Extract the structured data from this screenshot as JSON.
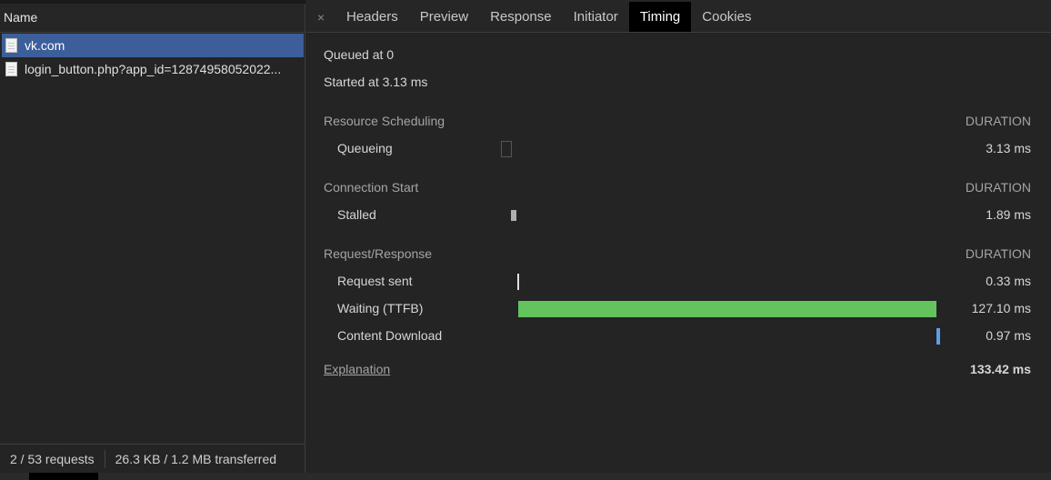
{
  "requests_panel": {
    "header": "Name",
    "items": [
      {
        "name": "vk.com",
        "selected": true
      },
      {
        "name": "login_button.php?app_id=12874958052022...",
        "selected": false
      }
    ],
    "status": {
      "requests": "2 / 53 requests",
      "transferred": "26.3 KB / 1.2 MB transferred"
    }
  },
  "tabs": {
    "close_glyph": "×",
    "items": [
      "Headers",
      "Preview",
      "Response",
      "Initiator",
      "Timing",
      "Cookies"
    ],
    "active": "Timing"
  },
  "timing": {
    "queued_at": "Queued at 0",
    "started_at": "Started at 3.13 ms",
    "sections": [
      {
        "title": "Resource Scheduling",
        "duration_header": "DURATION",
        "rows": [
          {
            "label": "Queueing",
            "value": "3.13 ms",
            "start_ms": 0,
            "duration_ms": 3.13,
            "color": "#242424",
            "outline": "#555555"
          }
        ]
      },
      {
        "title": "Connection Start",
        "duration_header": "DURATION",
        "rows": [
          {
            "label": "Stalled",
            "value": "1.89 ms",
            "start_ms": 3.13,
            "duration_ms": 1.89,
            "color": "#b0b0b0"
          }
        ]
      },
      {
        "title": "Request/Response",
        "duration_header": "DURATION",
        "rows": [
          {
            "label": "Request sent",
            "value": "0.33 ms",
            "start_ms": 5.02,
            "duration_ms": 0.33,
            "color": "#e0e0e0"
          },
          {
            "label": "Waiting (TTFB)",
            "value": "127.10 ms",
            "start_ms": 5.35,
            "duration_ms": 127.1,
            "color": "#63c35d"
          },
          {
            "label": "Content Download",
            "value": "0.97 ms",
            "start_ms": 132.45,
            "duration_ms": 0.97,
            "color": "#5a9ee6"
          }
        ]
      }
    ],
    "explanation": "Explanation",
    "total": "133.42 ms",
    "total_ms": 133.42
  }
}
